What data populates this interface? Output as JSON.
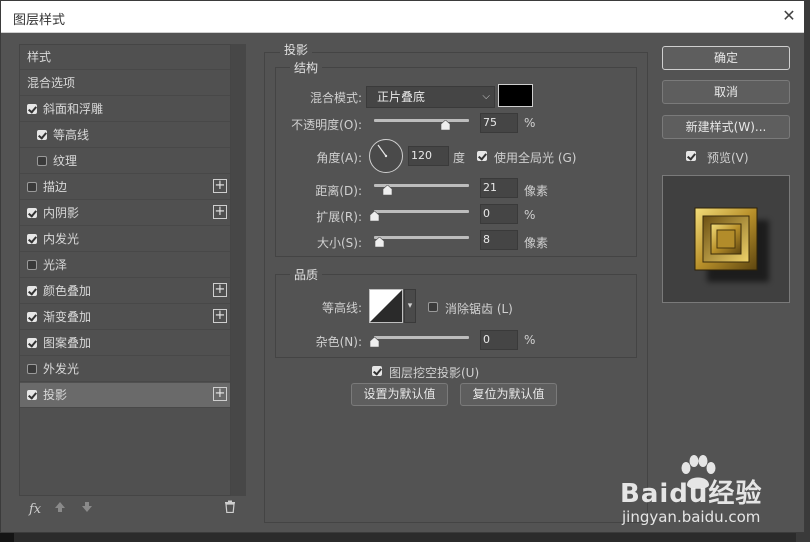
{
  "window": {
    "title": "图层样式",
    "close_icon": "close-icon"
  },
  "left_list": {
    "header": "样式",
    "items": [
      {
        "label": "混合选项",
        "has_checkbox": false,
        "checked": false,
        "indent": 0,
        "has_plus": false,
        "selected": false
      },
      {
        "label": "斜面和浮雕",
        "has_checkbox": true,
        "checked": true,
        "indent": 0,
        "has_plus": false,
        "selected": false
      },
      {
        "label": "等高线",
        "has_checkbox": true,
        "checked": true,
        "indent": 1,
        "has_plus": false,
        "selected": false
      },
      {
        "label": "纹理",
        "has_checkbox": true,
        "checked": false,
        "indent": 1,
        "has_plus": false,
        "selected": false
      },
      {
        "label": "描边",
        "has_checkbox": true,
        "checked": false,
        "indent": 0,
        "has_plus": true,
        "selected": false
      },
      {
        "label": "内阴影",
        "has_checkbox": true,
        "checked": true,
        "indent": 0,
        "has_plus": true,
        "selected": false
      },
      {
        "label": "内发光",
        "has_checkbox": true,
        "checked": true,
        "indent": 0,
        "has_plus": false,
        "selected": false
      },
      {
        "label": "光泽",
        "has_checkbox": true,
        "checked": false,
        "indent": 0,
        "has_plus": false,
        "selected": false
      },
      {
        "label": "颜色叠加",
        "has_checkbox": true,
        "checked": true,
        "indent": 0,
        "has_plus": true,
        "selected": false
      },
      {
        "label": "渐变叠加",
        "has_checkbox": true,
        "checked": true,
        "indent": 0,
        "has_plus": true,
        "selected": false
      },
      {
        "label": "图案叠加",
        "has_checkbox": true,
        "checked": true,
        "indent": 0,
        "has_plus": false,
        "selected": false
      },
      {
        "label": "外发光",
        "has_checkbox": true,
        "checked": false,
        "indent": 0,
        "has_plus": false,
        "selected": false
      },
      {
        "label": "投影",
        "has_checkbox": true,
        "checked": true,
        "indent": 0,
        "has_plus": true,
        "selected": true
      }
    ],
    "footer": {
      "fx_label": "fx",
      "up_icon": "arrow-up-icon",
      "down_icon": "arrow-down-icon",
      "trash_icon": "trash-icon"
    }
  },
  "panel": {
    "title": "投影",
    "structure": {
      "title": "结构",
      "blend_mode_label": "混合模式:",
      "blend_mode_value": "正片叠底",
      "shadow_color": "#000000",
      "opacity_label": "不透明度(O):",
      "opacity_value": "75",
      "opacity_unit": "%",
      "angle_label": "角度(A):",
      "angle_value": "120",
      "angle_unit": "度",
      "global_light_label": "使用全局光 (G)",
      "global_light_checked": true,
      "distance_label": "距离(D):",
      "distance_value": "21",
      "distance_unit": "像素",
      "spread_label": "扩展(R):",
      "spread_value": "0",
      "spread_unit": "%",
      "size_label": "大小(S):",
      "size_value": "8",
      "size_unit": "像素"
    },
    "quality": {
      "title": "品质",
      "contour_label": "等高线:",
      "anti_alias_label": "消除锯齿 (L)",
      "anti_alias_checked": false,
      "noise_label": "杂色(N):",
      "noise_value": "0",
      "noise_unit": "%"
    },
    "knockout_label": "图层挖空投影(U)",
    "knockout_checked": true,
    "set_default_label": "设置为默认值",
    "reset_default_label": "复位为默认值"
  },
  "sliders": {
    "opacity_pct": 75,
    "distance_pct": 14,
    "spread_pct": 0,
    "size_pct": 6,
    "noise_pct": 0
  },
  "right": {
    "ok_label": "确定",
    "cancel_label": "取消",
    "new_style_label": "新建样式(W)...",
    "preview_label": "预览(V)",
    "preview_checked": true
  },
  "watermark": {
    "text": "Baidu经验",
    "sub": "jingyan.baidu.com"
  },
  "colors": {
    "dialog_bg": "#535353",
    "selected_row": "#6a6a6a",
    "gold": "#c9a53a"
  }
}
